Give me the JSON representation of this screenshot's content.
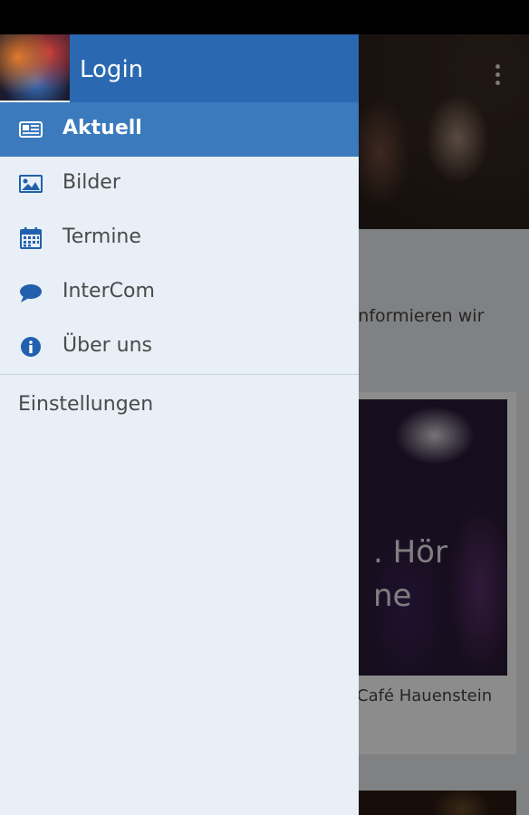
{
  "drawer": {
    "title": "Login",
    "items": [
      {
        "label": "Aktuell",
        "icon": "newspaper-icon",
        "active": true
      },
      {
        "label": "Bilder",
        "icon": "image-icon",
        "active": false
      },
      {
        "label": "Termine",
        "icon": "calendar-icon",
        "active": false
      },
      {
        "label": "InterCom",
        "icon": "chat-bubble-icon",
        "active": false
      },
      {
        "label": "Über uns",
        "icon": "info-icon",
        "active": false
      }
    ],
    "settings_label": "Einstellungen"
  },
  "background": {
    "intro_text": "informieren wir",
    "intro_text_2": ".",
    "card_overlay_line1": ". Hör",
    "card_overlay_line2": "ne",
    "card_caption": "Café Hauenstein"
  },
  "colors": {
    "header_blue": "#2a69b1",
    "active_item_blue": "#3a7abd",
    "icon_blue": "#2160ad",
    "drawer_bg": "#e8eff7"
  }
}
